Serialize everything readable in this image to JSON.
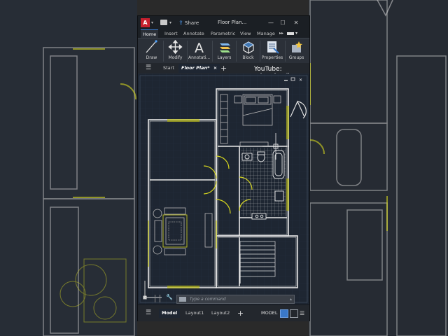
{
  "window": {
    "title": "Floor Plan...",
    "share_label": "Share",
    "app_badge": "A"
  },
  "ribbon": {
    "tabs": [
      "Home",
      "Insert",
      "Annotate",
      "Parametric",
      "View",
      "Manage"
    ],
    "active_tab": "Home",
    "buttons": [
      "Draw",
      "Modify",
      "Annotati...",
      "Layers",
      "Block",
      "Properties",
      "Groups"
    ]
  },
  "file_tabs": {
    "items": [
      "Start",
      "Floor Plan*"
    ],
    "active": "Floor Plan*",
    "close_glyph": "×",
    "add_glyph": "+"
  },
  "overlay": {
    "watermark": "YouTube: adamdereli"
  },
  "command_line": {
    "placeholder": "Type a command"
  },
  "status_bar": {
    "layout_tabs": [
      "Model",
      "Layout1",
      "Layout2"
    ],
    "active": "Model",
    "model_label": "MODEL",
    "add_glyph": "+"
  },
  "colors": {
    "accent": "#3a78c8",
    "walls": "#e8e8e8",
    "doors": "#d7d81e",
    "furniture": "#b8b8b8",
    "canvas_bg": "#1e2632",
    "grid": "#26303d"
  }
}
